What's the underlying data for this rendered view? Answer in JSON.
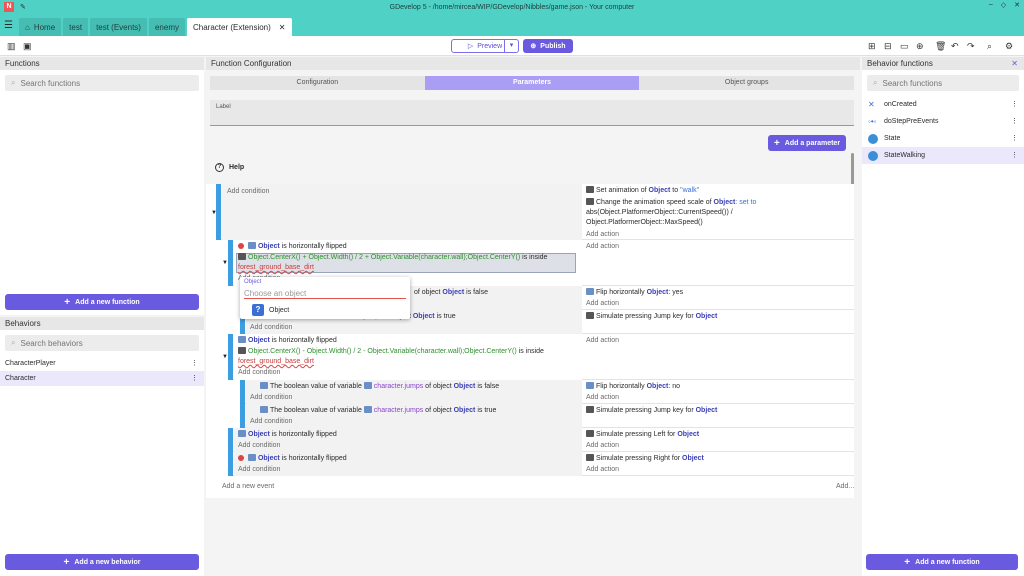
{
  "window": {
    "title": "GDevelop 5 - /home/mircea/WIP/GDevelop/Nibbles/game.json - Your computer"
  },
  "tabs": [
    "Home",
    "test",
    "test (Events)",
    "enemy",
    "Character (Extension)"
  ],
  "toolbar": {
    "preview": "Preview",
    "publish": "Publish"
  },
  "functions_panel": {
    "title": "Functions",
    "search_placeholder": "Search functions",
    "add_button": "Add a new function"
  },
  "behaviors_panel": {
    "title": "Behaviors",
    "search_placeholder": "Search behaviors",
    "items": [
      "CharacterPlayer",
      "Character"
    ],
    "add_button": "Add a new behavior"
  },
  "config": {
    "title": "Function Configuration",
    "tabs": [
      "Configuration",
      "Parameters",
      "Object groups"
    ],
    "label_field": "Label",
    "add_parameter": "Add a parameter",
    "help": "Help"
  },
  "behavior_functions": {
    "title": "Behavior functions",
    "search_placeholder": "Search functions",
    "items": [
      "onCreated",
      "doStepPreEvents",
      "State",
      "StateWalking"
    ],
    "add_button": "Add a new function"
  },
  "events": {
    "add_condition": "Add condition",
    "add_action": "Add action",
    "add_event": "Add a new event",
    "add_more": "Add...",
    "t_object": "Object",
    "t_is_flipped": "is horizontally flipped",
    "t_set_anim": "Set animation of",
    "t_to": "to",
    "t_walk": "\"walk\"",
    "t_change_speed": "Change the animation speed scale of",
    "t_set_to": ": set to",
    "t_abs": "abs(Object.PlatformerObject::CurrentSpeed()) /",
    "t_maxspeed": "Object.PlatformerObject::MaxSpeed()",
    "t_expr_plus": "Object.CenterX() + Object.Width() / 2 + Object.Variable(character.wall);Object.CenterY()",
    "t_expr_minus": "Object.CenterX() - Object.Width() / 2 - Object.Variable(character.wall);Object.CenterY()",
    "t_is_inside": "is inside",
    "t_forest": "forest_ground_base_dirt",
    "t_bool_var": "The boolean value of variable",
    "t_char_jumps": "character.jumps",
    "t_jumps": "jumps",
    "t_of_object": "of object",
    "t_is_false": "is false",
    "t_is_true": "is true",
    "t_flip_h": "Flip horizontally",
    "t_yes": ": yes",
    "t_no": ": no",
    "t_sim_jump": "Simulate pressing Jump key for",
    "t_sim_left": "Simulate pressing Left for",
    "t_sim_right": "Simulate pressing Right for"
  },
  "popup": {
    "label": "Object",
    "placeholder": "Choose an object",
    "option": "Object"
  }
}
